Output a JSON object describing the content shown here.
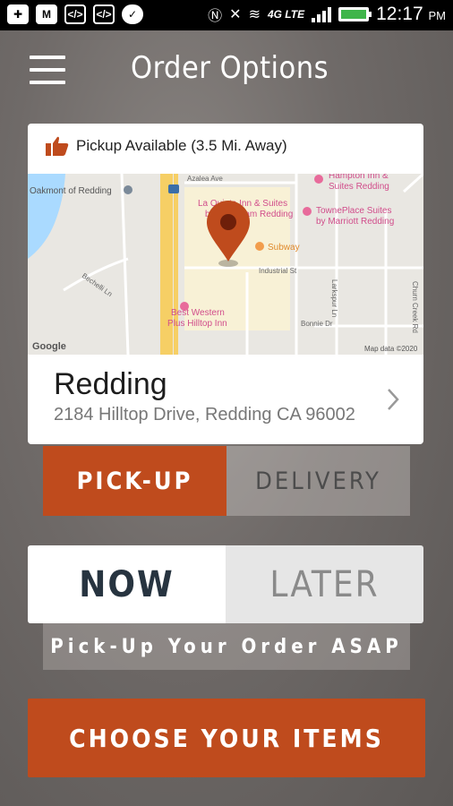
{
  "status_bar": {
    "time": "12:17",
    "ampm": "PM",
    "network": "4G LTE",
    "icons": [
      "plus-icon",
      "gmail-icon",
      "code-icon",
      "code-icon",
      "chat-icon",
      "nfc-icon",
      "mute-icon",
      "wifi-icon",
      "signal-icon",
      "battery-icon"
    ]
  },
  "header": {
    "title": "Order Options",
    "menu_icon": "hamburger-menu-icon"
  },
  "store": {
    "availability": "Pickup Available (3.5 Mi. Away)",
    "name": "Redding",
    "address": "2184 Hilltop Drive, Redding CA 96002",
    "map": {
      "labels": {
        "oakmont": "Oakmont of Redding",
        "hampton": "Hampton Inn &",
        "hampton2": "Suites Redding",
        "la_quinta": "La Quinta Inn & Suites",
        "la_quinta2": "by Wyndham Redding",
        "towneplace": "TownePlace Suites",
        "towneplace2": "by Marriott Redding",
        "subway": "Subway",
        "best_western": "Best Western",
        "best_western2": "Plus Hilltop Inn",
        "industrial": "Industrial St",
        "browning": "Browning St",
        "bechelli": "Bechelli Ln",
        "azalea": "Azalea Ave",
        "churn": "Churn Creek Rd",
        "larkspur": "Larkspur Ln",
        "bonnie": "Bonnie Dr",
        "google": "Google",
        "copyright": "Map data ©2020"
      },
      "highway": "5"
    }
  },
  "order_type": {
    "options": [
      "PICK-UP",
      "DELIVERY"
    ],
    "selected": "PICK-UP"
  },
  "timing": {
    "options": [
      "NOW",
      "LATER"
    ],
    "selected": "NOW"
  },
  "asap_text": "Pick-Up Your Order ASAP",
  "cta": {
    "label": "CHOOSE YOUR ITEMS"
  },
  "colors": {
    "accent": "#bf4b1d",
    "dark_text": "#273440"
  }
}
